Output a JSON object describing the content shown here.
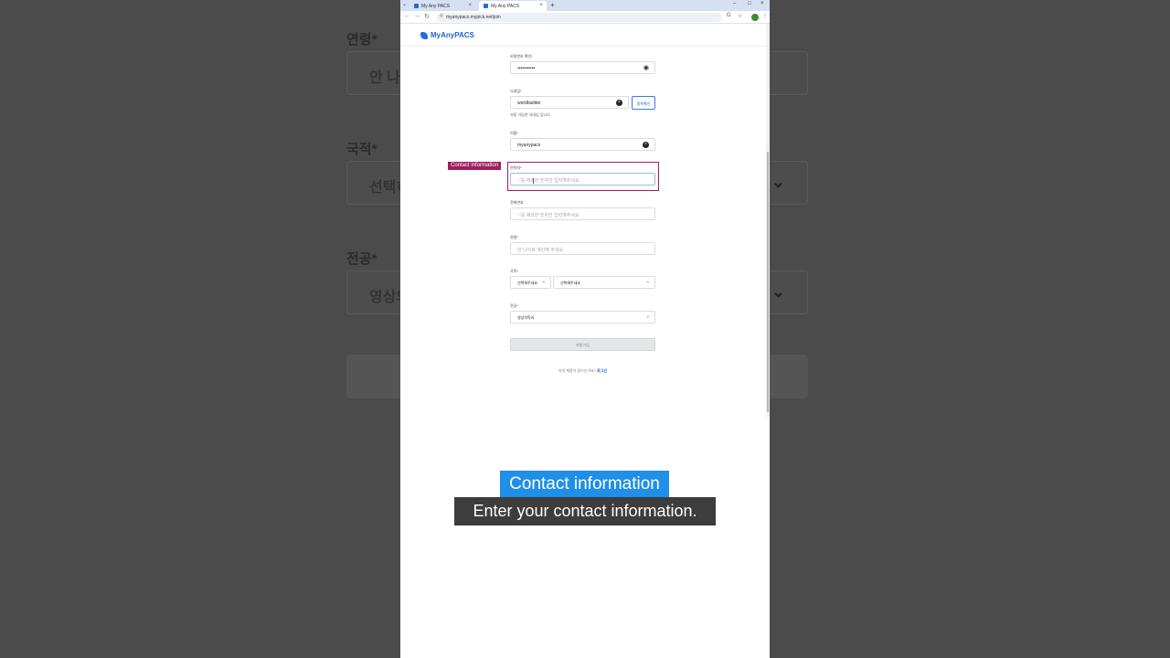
{
  "background": {
    "labels": [
      "연령*",
      "국적*",
      "전공*"
    ],
    "age_placeholder": "안 나",
    "nationality_value": "선택히",
    "major_value": "영상의"
  },
  "browser": {
    "tabs": [
      {
        "title": "My Any PACS",
        "active": false
      },
      {
        "title": "My Any PACS",
        "active": true
      }
    ],
    "url": "myanypacs.mypick.net/join"
  },
  "page": {
    "logo": "MyAnyPACS",
    "fields": {
      "password_confirm": {
        "label": "비밀번호 확인*",
        "value": "•••••••••••"
      },
      "nickname": {
        "label": "닉네임*",
        "value": "wordbuilder",
        "check_button": "중복확인",
        "hint": "사용 가능한 닉네임 입니다."
      },
      "name": {
        "label": "이름*",
        "value": "myanypacs"
      },
      "contact": {
        "label": "연락처*",
        "placeholder": "'-'를 제외한 숫자만 입력해주세요"
      },
      "phone": {
        "label": "전화번호",
        "placeholder": "'-'를 제외한 숫자만 입력해주세요"
      },
      "age": {
        "label": "연령*",
        "placeholder": "만 나이로 계산해 주세요"
      },
      "nationality": {
        "label": "국적*",
        "select1": "선택해주세요",
        "select2": "선택해주세요"
      },
      "major": {
        "label": "전공*",
        "value": "영상의학과"
      }
    },
    "submit_label": "회원가입",
    "login_prompt": "이미 계정이 있으신가요?",
    "login_link": "로그인"
  },
  "highlight": {
    "tag": "Contact information",
    "color": "#a01f5e"
  },
  "captions": {
    "title": "Contact information",
    "subtitle": "Enter your contact information.",
    "title_color": "#1f8fe8"
  }
}
